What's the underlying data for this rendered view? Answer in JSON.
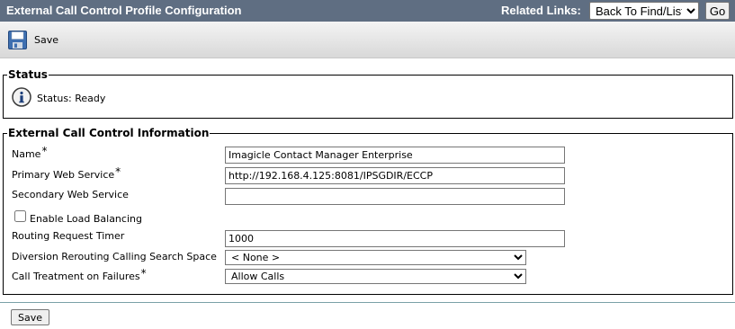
{
  "header": {
    "title": "External Call Control Profile Configuration",
    "related_links_label": "Related Links:",
    "related_links_selected": "Back To Find/List",
    "go_label": "Go"
  },
  "toolbar": {
    "save_label": "Save",
    "save_icon": "floppy-disk-icon"
  },
  "status": {
    "legend": "Status",
    "text": "Status: Ready",
    "icon": "info-icon"
  },
  "ecc": {
    "legend": "External Call Control Information",
    "name_label": "Name",
    "name_value": "Imagicle Contact Manager Enterprise",
    "primary_label": "Primary Web Service",
    "primary_value": "http://192.168.4.125:8081/IPSGDIR/ECCP",
    "secondary_label": "Secondary Web Service",
    "secondary_value": "",
    "load_balancing_label": "Enable Load Balancing",
    "load_balancing_checked": false,
    "timer_label": "Routing Request Timer",
    "timer_value": "1000",
    "css_label": "Diversion Rerouting Calling Search Space",
    "css_value": "< None >",
    "treatment_label": "Call Treatment on Failures",
    "treatment_value": "Allow Calls",
    "required_mark": "*"
  },
  "footer": {
    "save_label": "Save"
  },
  "colors": {
    "titlebar_bg": "#5f6e82",
    "divider": "#7aa1a8"
  }
}
